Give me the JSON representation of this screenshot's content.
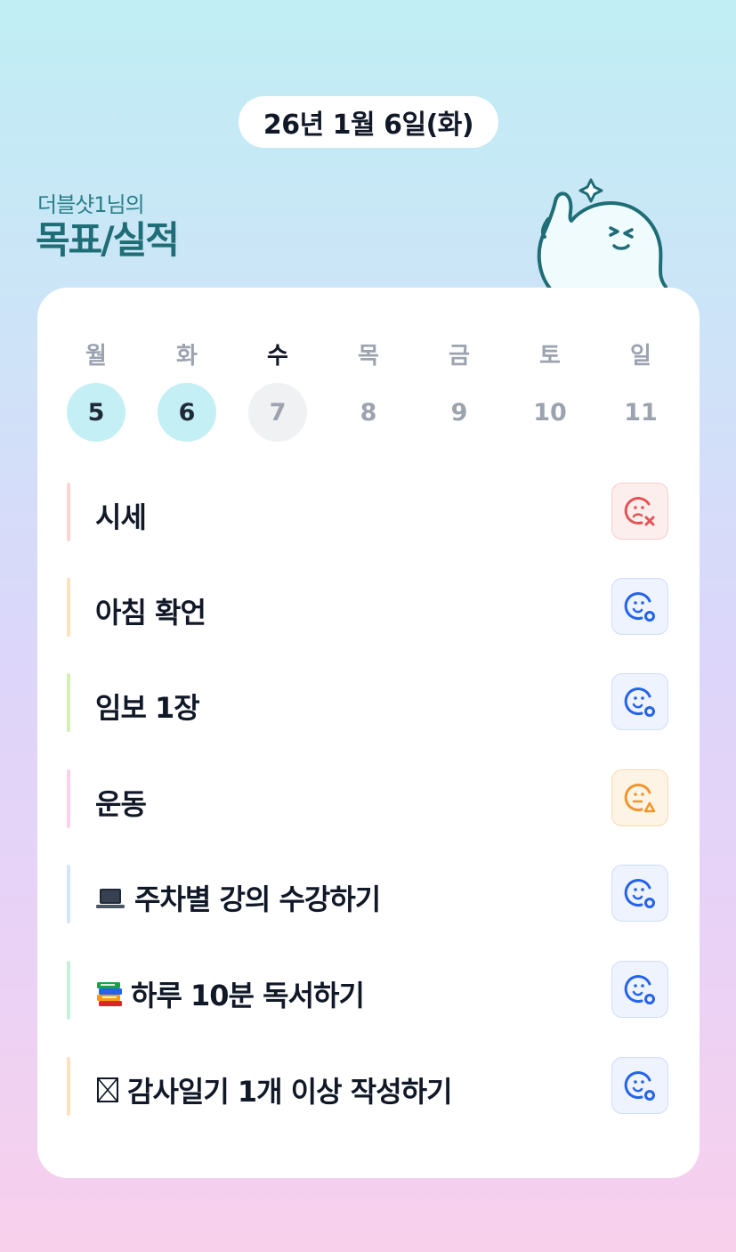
{
  "date_title": "26년 1월 6일(화)",
  "owner_label": "더블샷1님의",
  "heading": "목표/실적",
  "week": [
    {
      "day": "월",
      "num": "5",
      "state": "done"
    },
    {
      "day": "화",
      "num": "6",
      "state": "done"
    },
    {
      "day": "수",
      "num": "7",
      "state": "today"
    },
    {
      "day": "목",
      "num": "8",
      "state": "none"
    },
    {
      "day": "금",
      "num": "9",
      "state": "none"
    },
    {
      "day": "토",
      "num": "10",
      "state": "none"
    },
    {
      "day": "일",
      "num": "11",
      "state": "none"
    }
  ],
  "goals": [
    {
      "label": "시세",
      "icon": "",
      "bar_color": "#fbd5d5",
      "status": "bad",
      "status_icon": "face-x-icon"
    },
    {
      "label": "아침 확언",
      "icon": "",
      "bar_color": "#fde0bd",
      "status": "good",
      "status_icon": "face-o-icon"
    },
    {
      "label": "임보 1장",
      "icon": "",
      "bar_color": "#d4f0b4",
      "status": "good",
      "status_icon": "face-o-icon"
    },
    {
      "label": "운동",
      "icon": "",
      "bar_color": "#f9d2ea",
      "status": "mid",
      "status_icon": "face-triangle-icon"
    },
    {
      "label": "주차별 강의 수강하기",
      "icon": "laptop-icon",
      "bar_color": "#d7e3f8",
      "status": "good",
      "status_icon": "face-o-icon"
    },
    {
      "label": "하루 10분 독서하기",
      "icon": "books-icon",
      "bar_color": "#c6f0dc",
      "status": "good",
      "status_icon": "face-o-icon"
    },
    {
      "label": "감사일기 1개 이상 작성하기",
      "icon": "boxed-x-icon",
      "bar_color": "#fde0bd",
      "status": "good",
      "status_icon": "face-o-icon"
    }
  ],
  "colors": {
    "good": "#2563eb",
    "bad": "#e25454",
    "mid": "#f0962e",
    "heading": "#1f6d76"
  }
}
